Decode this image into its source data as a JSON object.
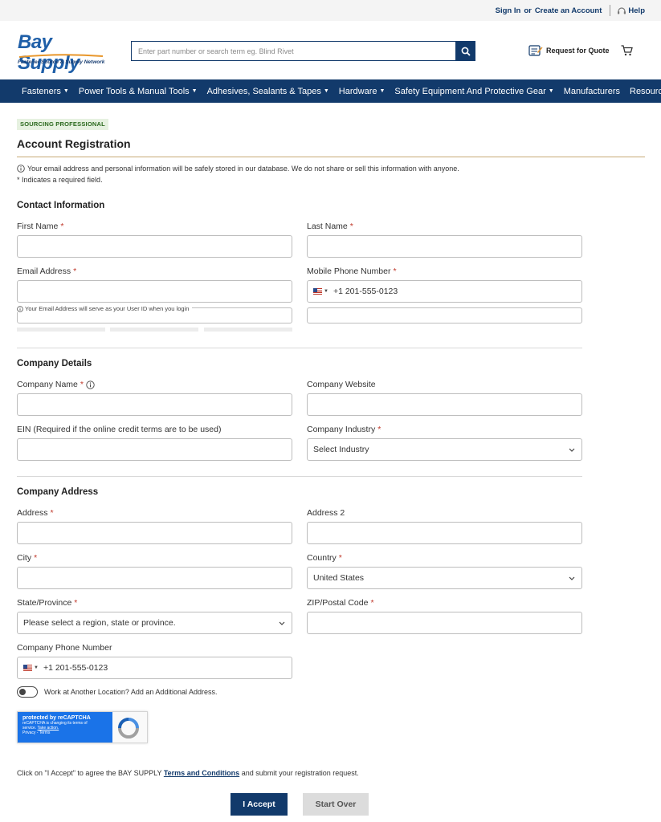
{
  "utility": {
    "sign_in": "Sign In",
    "or": "or",
    "create_account": "Create an Account",
    "help": "Help"
  },
  "brand": {
    "name": "Bay Supply",
    "tagline": "Fastener Source & Supply Network",
    "primary_color": "#123a6b",
    "logo_color": "#1f5fa8"
  },
  "search": {
    "placeholder": "Enter part number or search term eg. Blind Rivet"
  },
  "header": {
    "rfq_label": "Request for Quote"
  },
  "nav": {
    "items": [
      {
        "label": "Fasteners",
        "dropdown": true
      },
      {
        "label": "Power Tools & Manual Tools",
        "dropdown": true
      },
      {
        "label": "Adhesives, Sealants & Tapes",
        "dropdown": true
      },
      {
        "label": "Hardware",
        "dropdown": true
      },
      {
        "label": "Safety Equipment And Protective Gear",
        "dropdown": true
      },
      {
        "label": "Manufacturers",
        "dropdown": false
      },
      {
        "label": "Resources",
        "dropdown": false
      }
    ]
  },
  "page": {
    "badge": "SOURCING PROFESSIONAL",
    "title": "Account Registration",
    "privacy_note": "Your email address and personal information will be safely stored in our database. We do not share or sell this information with anyone.",
    "required_note": "* Indicates a required field."
  },
  "contact": {
    "section_title": "Contact Information",
    "first_name_label": "First Name",
    "last_name_label": "Last Name",
    "email_label": "Email Address",
    "mobile_label": "Mobile Phone Number",
    "mobile_value": "+1 201-555-0123",
    "email_hint": "Your Email Address will serve as your User ID when you login"
  },
  "company": {
    "section_title": "Company Details",
    "name_label": "Company Name",
    "website_label": "Company Website",
    "ein_label": "EIN (Required if the online credit terms are to be used)",
    "industry_label": "Company Industry",
    "industry_value": "Select Industry"
  },
  "address": {
    "section_title": "Company Address",
    "address_label": "Address",
    "address2_label": "Address 2",
    "city_label": "City",
    "country_label": "Country",
    "country_value": "United States",
    "state_label": "State/Province",
    "state_value": "Please select a region, state or province.",
    "zip_label": "ZIP/Postal Code",
    "phone_label": "Company Phone Number",
    "phone_value": "+1 201-555-0123",
    "additional_toggle_label": "Work at Another Location? Add an Additional Address."
  },
  "recaptcha": {
    "title": "protected by reCAPTCHA",
    "line1": "reCAPTCHA is changing its terms of",
    "line2_prefix": "service.",
    "take_action": "Take action.",
    "privacy": "Privacy",
    "terms": "Terms"
  },
  "footer": {
    "agree_prefix": "Click on \"I Accept\" to agree the BAY SUPPLY",
    "terms_link": "Terms and Conditions",
    "agree_suffix": "and submit your registration request.",
    "accept_button": "I Accept",
    "start_over_button": "Start Over"
  },
  "required_marker": "*"
}
